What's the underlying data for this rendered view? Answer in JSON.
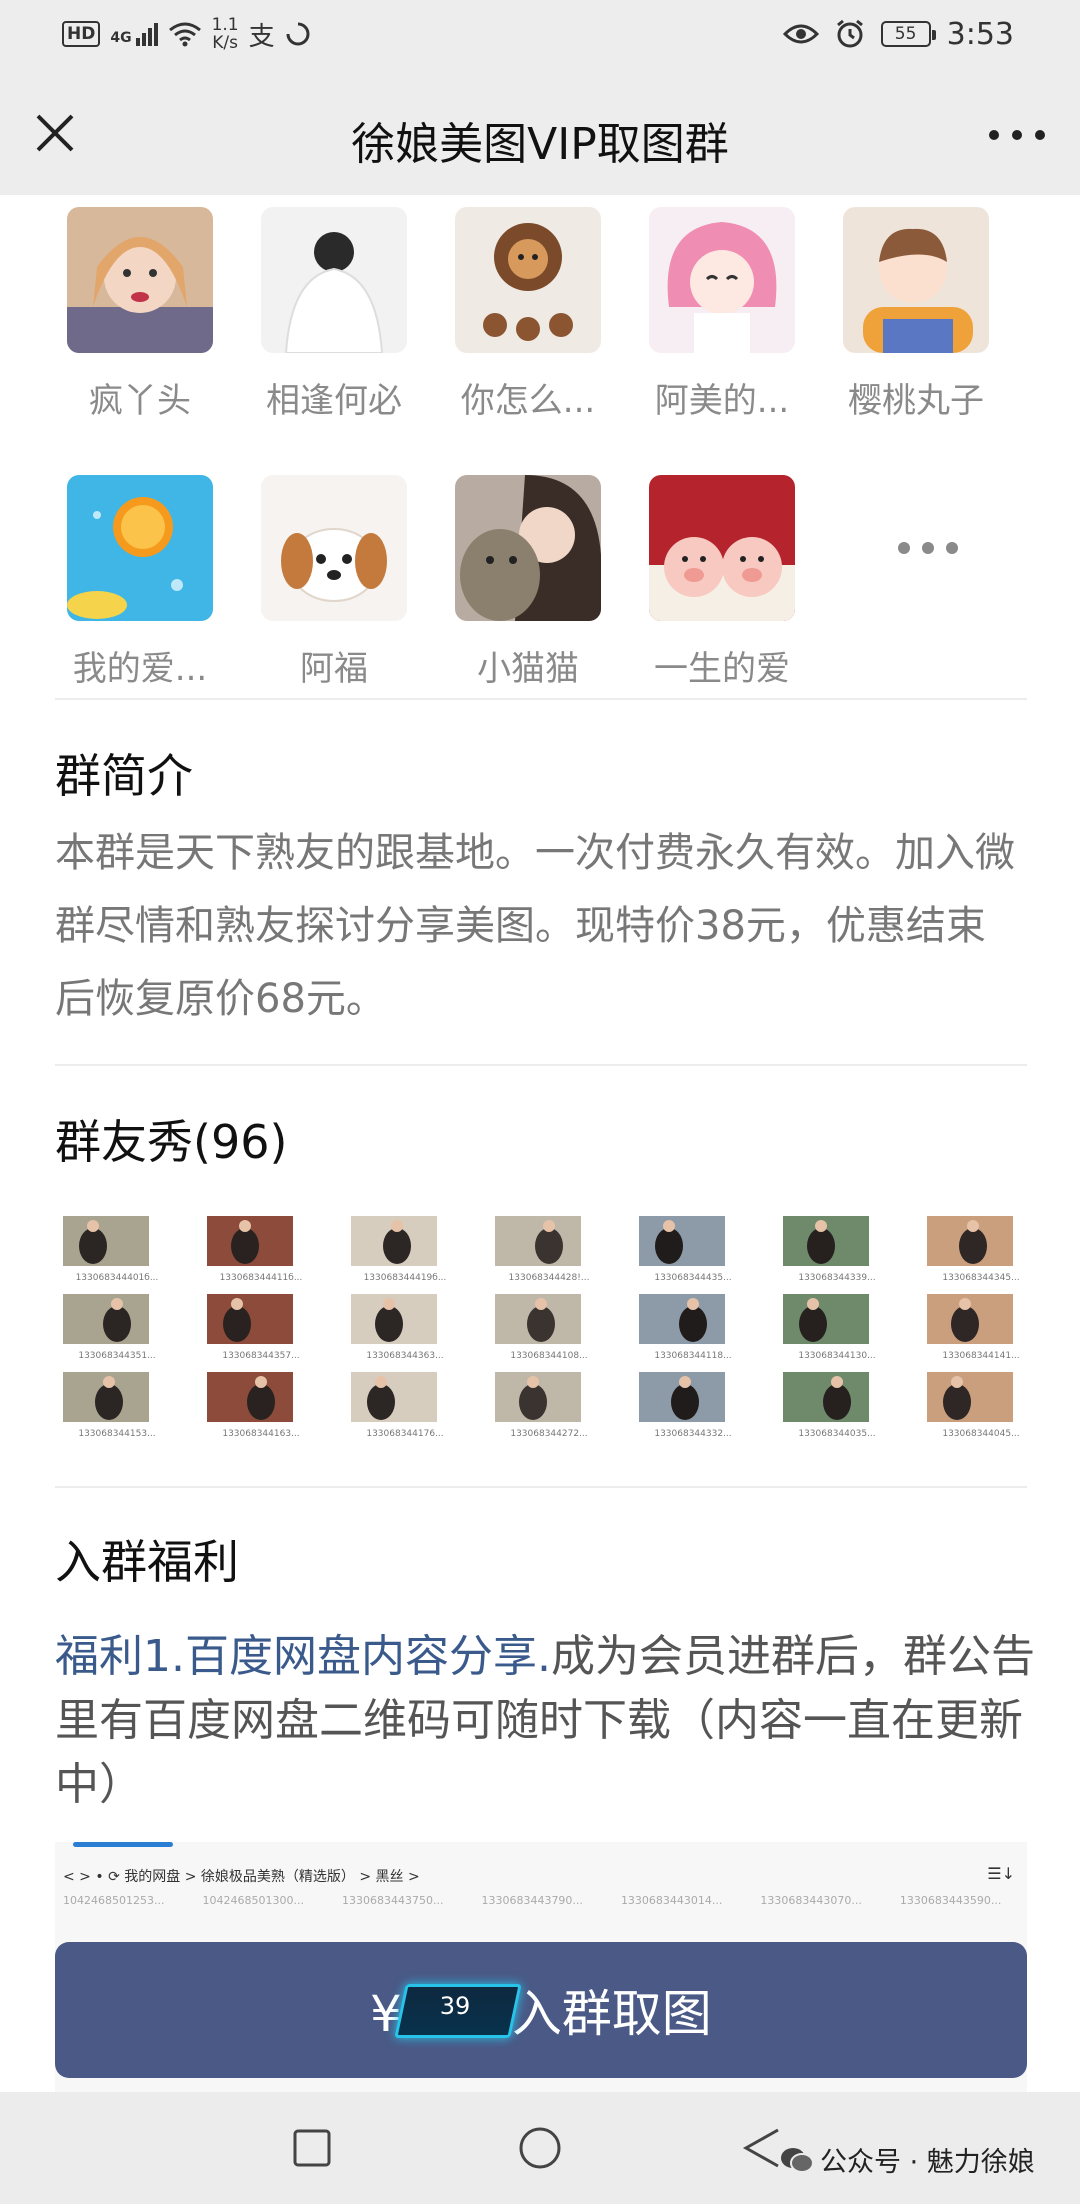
{
  "status_bar": {
    "network": "HD",
    "signal": "4G",
    "speed_value": "1.1",
    "speed_unit": "K/s",
    "battery": "55",
    "time": "3:53"
  },
  "header": {
    "title": "徐娘美图VIP取图群"
  },
  "members": [
    {
      "name": "疯丫头",
      "avatar": "avatar-girl-portrait"
    },
    {
      "name": "相逢何必",
      "avatar": "avatar-back-white-shirt"
    },
    {
      "name": "你怎么...",
      "avatar": "avatar-lion-cookie"
    },
    {
      "name": "阿美的...",
      "avatar": "avatar-pink-anime-girl"
    },
    {
      "name": "樱桃丸子",
      "avatar": "avatar-cartoon-boy"
    },
    {
      "name": "我的爱...",
      "avatar": "avatar-orange-slice"
    },
    {
      "name": "阿福",
      "avatar": "avatar-puppy"
    },
    {
      "name": "小猫猫",
      "avatar": "avatar-girl-with-cat"
    },
    {
      "name": "一生的爱",
      "avatar": "avatar-two-pigs"
    }
  ],
  "intro": {
    "title": "群简介",
    "text": "本群是天下熟友的跟基地。一次付费永久有效。加入微群尽情和熟友探讨分享美图。现特价38元，优惠结束后恢复原价68元。"
  },
  "showcase": {
    "title": "群友秀(96)",
    "photos": [
      "133068344401б...",
      "133068344411б...",
      "133068344419б...",
      "133068344428!...",
      "133068344435...",
      "133068344339...",
      "133068344345...",
      "133068344351...",
      "133068344357...",
      "133068344363...",
      "133068344108...",
      "133068344118...",
      "133068344130...",
      "133068344141...",
      "133068344153...",
      "133068344163...",
      "133068344176...",
      "133068344272...",
      "133068344332...",
      "133068344035...",
      "133068344045..."
    ]
  },
  "benefits": {
    "title": "入群福利",
    "highlight": "福利1.百度网盘内容分享.",
    "text": "成为会员进群后，群公告里有百度网盘二维码可随时下载（内容一直在更新中）"
  },
  "pan_preview": {
    "breadcrumb": "<   >   •   ⟳      我的网盘  >  徐娘极品美熟（精选版）  >  黑丝  >",
    "files": [
      "1042468501253...",
      "1042468501300...",
      "1330683443750...",
      "1330683443790...",
      "1330683443014...",
      "1330683443070...",
      "1330683443590..."
    ]
  },
  "join_button": {
    "currency": "¥",
    "price": "39",
    "label": "入群取图"
  },
  "watermark": {
    "text": "公众号 · 魅力徐娘"
  },
  "colors": {
    "button": "#4a5986",
    "link_blue": "#3b5a8c",
    "bar_bg": "#ededed"
  }
}
